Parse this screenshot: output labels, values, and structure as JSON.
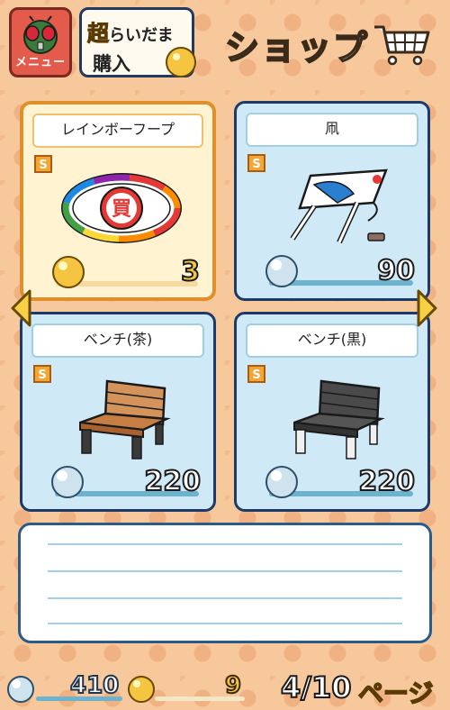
{
  "header": {
    "menu_label": "メニュー",
    "raidama_prefix": "超",
    "raidama_rest": "らいだま",
    "raidama_action": "購入",
    "title": "ショップ"
  },
  "items": [
    {
      "name": "レインボーフープ",
      "rank": "S",
      "price": "3",
      "currency": "coin",
      "selected": true,
      "icon": "rainbow-hoop-icon"
    },
    {
      "name": "凧",
      "rank": "S",
      "price": "90",
      "currency": "pearl",
      "selected": false,
      "icon": "kite-icon"
    },
    {
      "name": "ベンチ(茶)",
      "rank": "S",
      "price": "220",
      "currency": "pearl",
      "selected": false,
      "icon": "brown-bench-icon"
    },
    {
      "name": "ベンチ(黒)",
      "rank": "S",
      "price": "220",
      "currency": "pearl",
      "selected": false,
      "icon": "black-bench-icon"
    }
  ],
  "hoop_char": "買",
  "footer": {
    "pearls": "410",
    "coins": "9",
    "page": "4/10",
    "page_label": "ページ"
  },
  "colors": {
    "background": "#f7c89b",
    "card_border": "#1e3a6a",
    "card_fill": "#cfe9f6",
    "selected_fill": "#fff3d2",
    "selected_border": "#e0902a",
    "coin": "#f5c542",
    "menu": "#e25b4b"
  }
}
